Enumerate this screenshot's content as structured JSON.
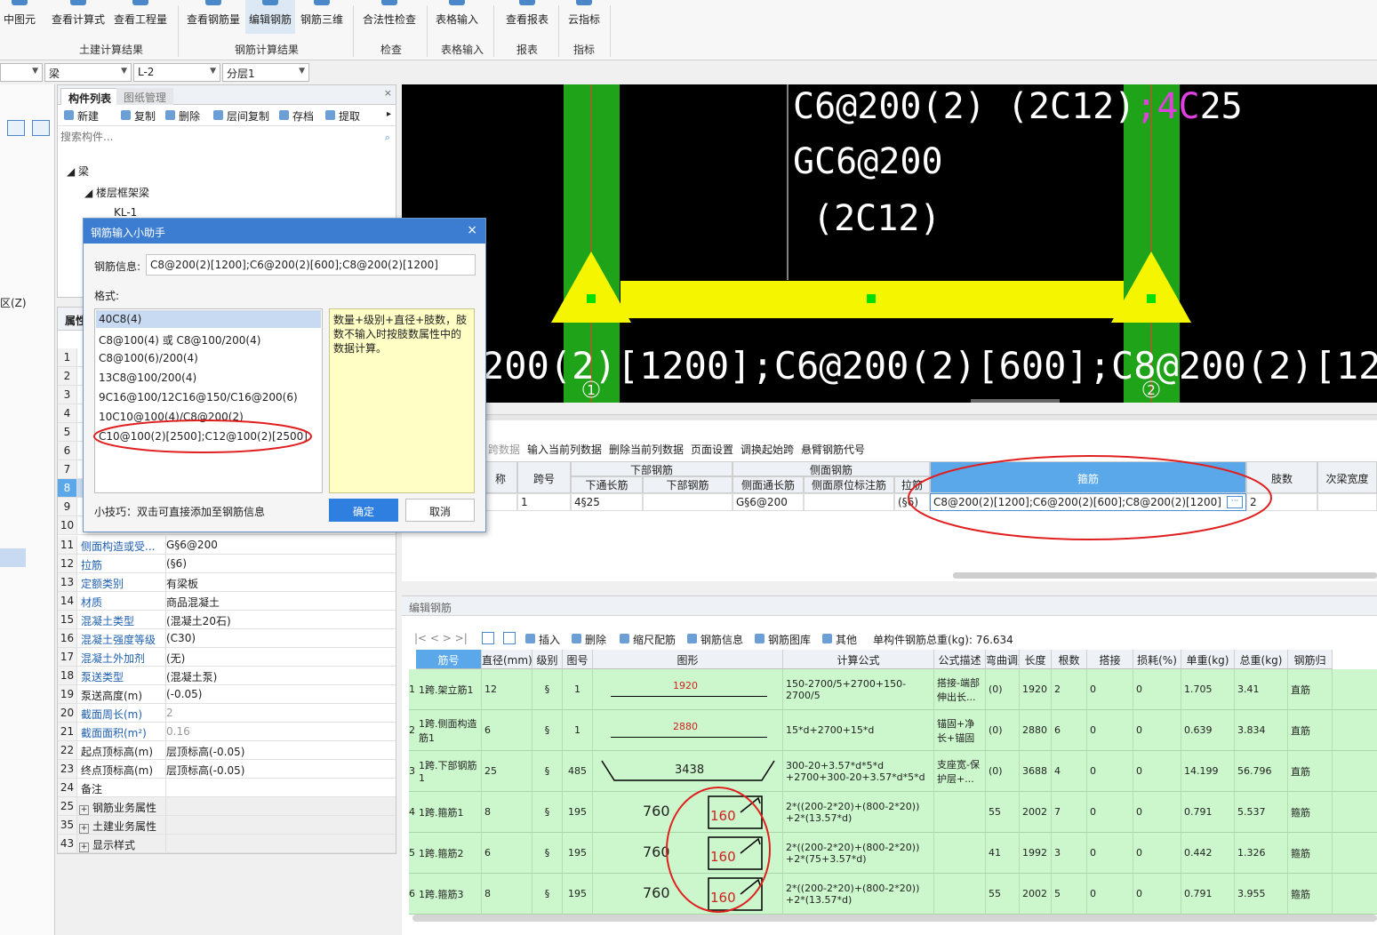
{
  "ribbon": {
    "buttons": [
      {
        "label": "中图元"
      },
      {
        "label": "查看计算式"
      },
      {
        "label": "查看工程量"
      },
      {
        "label": "查看钢筋量"
      },
      {
        "label": "编辑钢筋"
      },
      {
        "label": "钢筋三维"
      },
      {
        "label": "合法性检查"
      },
      {
        "label": "表格输入"
      },
      {
        "label": "查看报表"
      },
      {
        "label": "云指标"
      }
    ],
    "groups": [
      "土建计算结果",
      "钢筋计算结果",
      "检查",
      "表格输入",
      "报表",
      "指标"
    ]
  },
  "selectors": {
    "type": "梁",
    "name": "L-2",
    "layer": "分层1"
  },
  "left_strip": {
    "label": "区(Z)"
  },
  "component_panel": {
    "tab_list": "构件列表",
    "tab_drawing": "图纸管理",
    "tools": [
      "新建",
      "复制",
      "删除",
      "层间复制",
      "存档",
      "提取"
    ],
    "search_placeholder": "搜索构件...",
    "tree_root": "梁",
    "tree_child": "楼层框架梁",
    "tree_leaf": "KL-1"
  },
  "property_panel": {
    "tab": "属性",
    "row_nums_top": [
      "1",
      "2",
      "3",
      "4",
      "5",
      "6",
      "7",
      "8",
      "9",
      "10"
    ],
    "rows": [
      {
        "n": "11",
        "k": "侧面构造或受...",
        "v": "G§6@200",
        "blue": true
      },
      {
        "n": "12",
        "k": "拉筋",
        "v": "(§6)",
        "blue": true
      },
      {
        "n": "13",
        "k": "定额类别",
        "v": "有梁板",
        "blue": true
      },
      {
        "n": "14",
        "k": "材质",
        "v": "商品混凝土",
        "blue": true
      },
      {
        "n": "15",
        "k": "混凝土类型",
        "v": "(混凝土20石)",
        "blue": true
      },
      {
        "n": "16",
        "k": "混凝土强度等级",
        "v": "(C30)",
        "blue": true
      },
      {
        "n": "17",
        "k": "混凝土外加剂",
        "v": "(无)",
        "blue": true
      },
      {
        "n": "18",
        "k": "泵送类型",
        "v": "(混凝土泵)",
        "blue": true
      },
      {
        "n": "19",
        "k": "泵送高度(m)",
        "v": "(-0.05)",
        "blue": false
      },
      {
        "n": "20",
        "k": "截面周长(m)",
        "v": "2",
        "blue": true,
        "gray": true
      },
      {
        "n": "21",
        "k": "截面面积(m²)",
        "v": "0.16",
        "blue": true,
        "gray": true
      },
      {
        "n": "22",
        "k": "起点顶标高(m)",
        "v": "层顶标高(-0.05)",
        "blue": false
      },
      {
        "n": "23",
        "k": "终点顶标高(m)",
        "v": "层顶标高(-0.05)",
        "blue": false
      },
      {
        "n": "24",
        "k": "备注",
        "v": "",
        "blue": false
      },
      {
        "n": "25",
        "k": "钢筋业务属性",
        "v": "",
        "blue": false,
        "group": true
      },
      {
        "n": "35",
        "k": "土建业务属性",
        "v": "",
        "blue": false,
        "group": true
      },
      {
        "n": "43",
        "k": "显示样式",
        "v": "",
        "blue": false,
        "group": true
      }
    ]
  },
  "dialog": {
    "title": "钢筋输入小助手",
    "info_label": "钢筋信息:",
    "info_value": "C8@200(2)[1200];C6@200(2)[600];C8@200(2)[1200]",
    "format_label": "格式:",
    "formats": [
      "40C8(4)",
      "C8@100(4) 或 C8@100/200(4)",
      "C8@100(6)/200(4)",
      "13C8@100/200(4)",
      "9C16@100/12C16@150/C16@200(6)",
      "10C10@100(4)/C8@200(2)",
      "C10@100(2)[2500];C12@100(2)[2500]"
    ],
    "tip_text": "数量+级别+直径+肢数，肢数不输入时按肢数属性中的数据计算。",
    "hint": "小技巧：双击可直接添加至钢筋信息",
    "ok": "确定",
    "cancel": "取消"
  },
  "cad": {
    "line1a": "C6@200(2) (2C12)",
    "line1b": ";4C",
    "line1c": "25",
    "line2": "GC6@200",
    "line3": "(2C12)",
    "bottom_text": "200(2)[1200];C6@200(2)[600];C8@200(2)[1200])",
    "axis1": "1",
    "axis2": "2",
    "colors": {
      "column": "#1fa319",
      "beam": "#f5f500",
      "grip": "#00e000",
      "magenta": "#e040e0"
    }
  },
  "span_table": {
    "tools": [
      "跨数据",
      "输入当前列数据",
      "删除当前列数据",
      "页面设置",
      "调换起始跨",
      "悬臂钢筋代号"
    ],
    "headers": {
      "name": "称",
      "span": "跨号",
      "bottom": "下部钢筋",
      "bottom_through": "下通长筋",
      "bottom_bar": "下部钢筋",
      "side": "侧面钢筋",
      "side_through": "侧面通长筋",
      "side_origin": "侧面原位标注筋",
      "tie": "拉筋",
      "stirrup": "箍筋",
      "legs": "肢数",
      "sub_width": "次梁宽度"
    },
    "row": {
      "span": "1",
      "bottom_through": "4§25",
      "side_through": "G§6@200",
      "tie": "(§6)",
      "stirrup": "C8@200(2)[1200];C6@200(2)[600];C8@200(2)[1200]",
      "legs": "2"
    }
  },
  "edit_rebar": {
    "title": "编辑钢筋",
    "nav": "|< < > >|",
    "tools": [
      "插入",
      "删除",
      "缩尺配筋",
      "钢筋信息",
      "钢筋图库",
      "其他"
    ],
    "total_weight_label": "单构件钢筋总重(kg):",
    "total_weight": "76.634",
    "headers": [
      "筋号",
      "直径(mm)",
      "级别",
      "图号",
      "图形",
      "计算公式",
      "公式描述",
      "弯曲调整",
      "长度",
      "根数",
      "搭接",
      "损耗(%)",
      "单重(kg)",
      "总重(kg)",
      "钢筋归"
    ],
    "rows": [
      {
        "no": "1",
        "name": "1跨.架立筋1",
        "dia": "12",
        "grade": "§",
        "fig": "1",
        "shape_val": "1920",
        "formula": "150-2700/5+2700+150-2700/5",
        "desc": "搭接-端部伸出长...",
        "bend": "(0)",
        "len": "1920",
        "count": "2",
        "lap": "0",
        "loss": "0",
        "unit": "1.705",
        "total": "3.41",
        "type": "直筋"
      },
      {
        "no": "2",
        "name": "1跨.侧面构造筋1",
        "dia": "6",
        "grade": "§",
        "fig": "1",
        "shape_val": "2880",
        "formula": "15*d+2700+15*d",
        "desc": "锚固+净长+锚固",
        "bend": "(0)",
        "len": "2880",
        "count": "6",
        "lap": "0",
        "loss": "0",
        "unit": "0.639",
        "total": "3.834",
        "type": "直筋"
      },
      {
        "no": "3",
        "name": "1跨.下部钢筋1",
        "dia": "25",
        "grade": "§",
        "fig": "485",
        "shape_val": "3438",
        "formula": "300-20+3.57*d*5*d +2700+300-20+3.57*d*5*d",
        "desc": "支座宽-保护层+...",
        "bend": "(0)",
        "len": "3688",
        "count": "4",
        "lap": "0",
        "loss": "0",
        "unit": "14.199",
        "total": "56.796",
        "type": "直筋"
      },
      {
        "no": "4",
        "name": "1跨.箍筋1",
        "dia": "8",
        "grade": "§",
        "fig": "195",
        "shape_a": "760",
        "shape_b": "160",
        "formula": "2*((200-2*20)+(800-2*20)) +2*(13.57*d)",
        "desc": "",
        "bend": "55",
        "len": "2002",
        "count": "7",
        "lap": "0",
        "loss": "0",
        "unit": "0.791",
        "total": "5.537",
        "type": "箍筋"
      },
      {
        "no": "5",
        "name": "1跨.箍筋2",
        "dia": "6",
        "grade": "§",
        "fig": "195",
        "shape_a": "760",
        "shape_b": "160",
        "formula": "2*((200-2*20)+(800-2*20)) +2*(75+3.57*d)",
        "desc": "",
        "bend": "41",
        "len": "1992",
        "count": "3",
        "lap": "0",
        "loss": "0",
        "unit": "0.442",
        "total": "1.326",
        "type": "箍筋"
      },
      {
        "no": "6",
        "name": "1跨.箍筋3",
        "dia": "8",
        "grade": "§",
        "fig": "195",
        "shape_a": "760",
        "shape_b": "160",
        "formula": "2*((200-2*20)+(800-2*20)) +2*(13.57*d)",
        "desc": "",
        "bend": "55",
        "len": "2002",
        "count": "5",
        "lap": "0",
        "loss": "0",
        "unit": "0.791",
        "total": "3.955",
        "type": "箍筋"
      }
    ]
  }
}
